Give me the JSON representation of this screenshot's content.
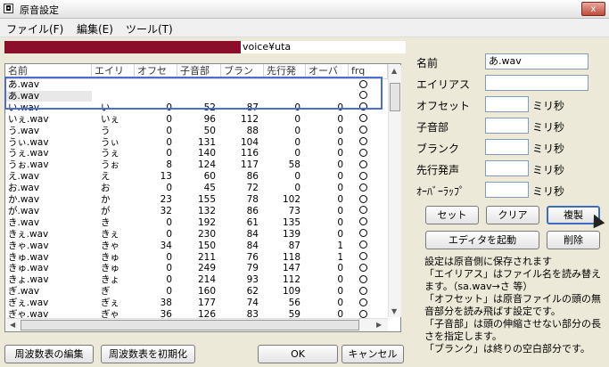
{
  "window": {
    "title": "原音設定",
    "close_glyph": "x"
  },
  "menu": {
    "file": "ファイル(F)",
    "edit": "編集(E)",
    "tools": "ツール(T)"
  },
  "path": {
    "text": "voice¥uta",
    "bar_color": "#8b0f2b"
  },
  "table": {
    "columns": [
      "名前",
      "エイリ",
      "オフセ",
      "子音部",
      "ブラン",
      "先行発",
      "オーバ",
      "frq"
    ],
    "rows": [
      {
        "name": "あ.wav",
        "alias": "",
        "offset": "",
        "consonant": "",
        "blank": "",
        "preutter": "",
        "overlap": "",
        "frq": true
      },
      {
        "name": "あ.wav",
        "alias": "",
        "offset": "",
        "consonant": "",
        "blank": "",
        "preutter": "",
        "overlap": "",
        "frq": true
      },
      {
        "name": "い.wav",
        "alias": "い",
        "offset": "0",
        "consonant": "52",
        "blank": "87",
        "preutter": "0",
        "overlap": "0",
        "frq": true
      },
      {
        "name": "いぇ.wav",
        "alias": "いぇ",
        "offset": "0",
        "consonant": "96",
        "blank": "112",
        "preutter": "0",
        "overlap": "0",
        "frq": true
      },
      {
        "name": "う.wav",
        "alias": "う",
        "offset": "0",
        "consonant": "50",
        "blank": "88",
        "preutter": "0",
        "overlap": "0",
        "frq": true
      },
      {
        "name": "うぃ.wav",
        "alias": "うぃ",
        "offset": "0",
        "consonant": "131",
        "blank": "104",
        "preutter": "0",
        "overlap": "0",
        "frq": true
      },
      {
        "name": "うぇ.wav",
        "alias": "うぇ",
        "offset": "0",
        "consonant": "140",
        "blank": "116",
        "preutter": "0",
        "overlap": "0",
        "frq": true
      },
      {
        "name": "うぉ.wav",
        "alias": "うぉ",
        "offset": "8",
        "consonant": "124",
        "blank": "117",
        "preutter": "58",
        "overlap": "0",
        "frq": true
      },
      {
        "name": "え.wav",
        "alias": "え",
        "offset": "13",
        "consonant": "60",
        "blank": "86",
        "preutter": "0",
        "overlap": "0",
        "frq": true
      },
      {
        "name": "お.wav",
        "alias": "お",
        "offset": "0",
        "consonant": "45",
        "blank": "72",
        "preutter": "0",
        "overlap": "0",
        "frq": true
      },
      {
        "name": "か.wav",
        "alias": "か",
        "offset": "23",
        "consonant": "155",
        "blank": "78",
        "preutter": "102",
        "overlap": "0",
        "frq": true
      },
      {
        "name": "が.wav",
        "alias": "が",
        "offset": "32",
        "consonant": "132",
        "blank": "86",
        "preutter": "73",
        "overlap": "0",
        "frq": true
      },
      {
        "name": "き.wav",
        "alias": "き",
        "offset": "0",
        "consonant": "192",
        "blank": "61",
        "preutter": "135",
        "overlap": "0",
        "frq": true
      },
      {
        "name": "きぇ.wav",
        "alias": "きぇ",
        "offset": "0",
        "consonant": "230",
        "blank": "84",
        "preutter": "139",
        "overlap": "0",
        "frq": true
      },
      {
        "name": "きゃ.wav",
        "alias": "きゃ",
        "offset": "34",
        "consonant": "150",
        "blank": "84",
        "preutter": "87",
        "overlap": "1",
        "frq": true
      },
      {
        "name": "きゅ.wav",
        "alias": "きゅ",
        "offset": "0",
        "consonant": "211",
        "blank": "76",
        "preutter": "118",
        "overlap": "1",
        "frq": true
      },
      {
        "name": "きゅ.wav",
        "alias": "きゅ",
        "offset": "0",
        "consonant": "249",
        "blank": "79",
        "preutter": "147",
        "overlap": "0",
        "frq": true
      },
      {
        "name": "きょ.wav",
        "alias": "きょ",
        "offset": "0",
        "consonant": "214",
        "blank": "93",
        "preutter": "112",
        "overlap": "0",
        "frq": true
      },
      {
        "name": "ぎ.wav",
        "alias": "ぎ",
        "offset": "0",
        "consonant": "160",
        "blank": "62",
        "preutter": "109",
        "overlap": "0",
        "frq": true
      },
      {
        "name": "ぎぇ.wav",
        "alias": "ぎぇ",
        "offset": "38",
        "consonant": "177",
        "blank": "74",
        "preutter": "56",
        "overlap": "0",
        "frq": true
      },
      {
        "name": "ぎゃ.wav",
        "alias": "ぎゃ",
        "offset": "36",
        "consonant": "126",
        "blank": "83",
        "preutter": "59",
        "overlap": "0",
        "frq": true
      }
    ]
  },
  "form": {
    "name_label": "名前",
    "name_value": "あ.wav",
    "alias_label": "エイリアス",
    "alias_value": "",
    "offset_label": "オフセット",
    "offset_value": "",
    "consonant_label": "子音部",
    "consonant_value": "",
    "blank_label": "ブランク",
    "blank_value": "",
    "preutter_label": "先行発声",
    "preutter_value": "",
    "overlap_label": "ｵｰﾊﾞｰﾗｯﾌﾟ",
    "overlap_value": "",
    "unit": "ミリ秒"
  },
  "buttons": {
    "set": "セット",
    "clear": "クリア",
    "copy": "複製",
    "launch_editor": "エディタを起動",
    "delete": "削除",
    "edit_freq": "周波数表の編集",
    "init_freq": "周波数表を初期化",
    "ok": "OK",
    "cancel": "キャンセル"
  },
  "notes": [
    "設定は原音側に保存されます",
    "「エイリアス」はファイル名を読み替えます。（sa.wav→さ 等）",
    "「オフセット」は原音ファイルの頭の無音部分を読み飛ばす設定です。",
    "「子音部」は頭の伸縮させない部分の長さを指定します。",
    "「ブランク」は終りの空白部分です。"
  ]
}
